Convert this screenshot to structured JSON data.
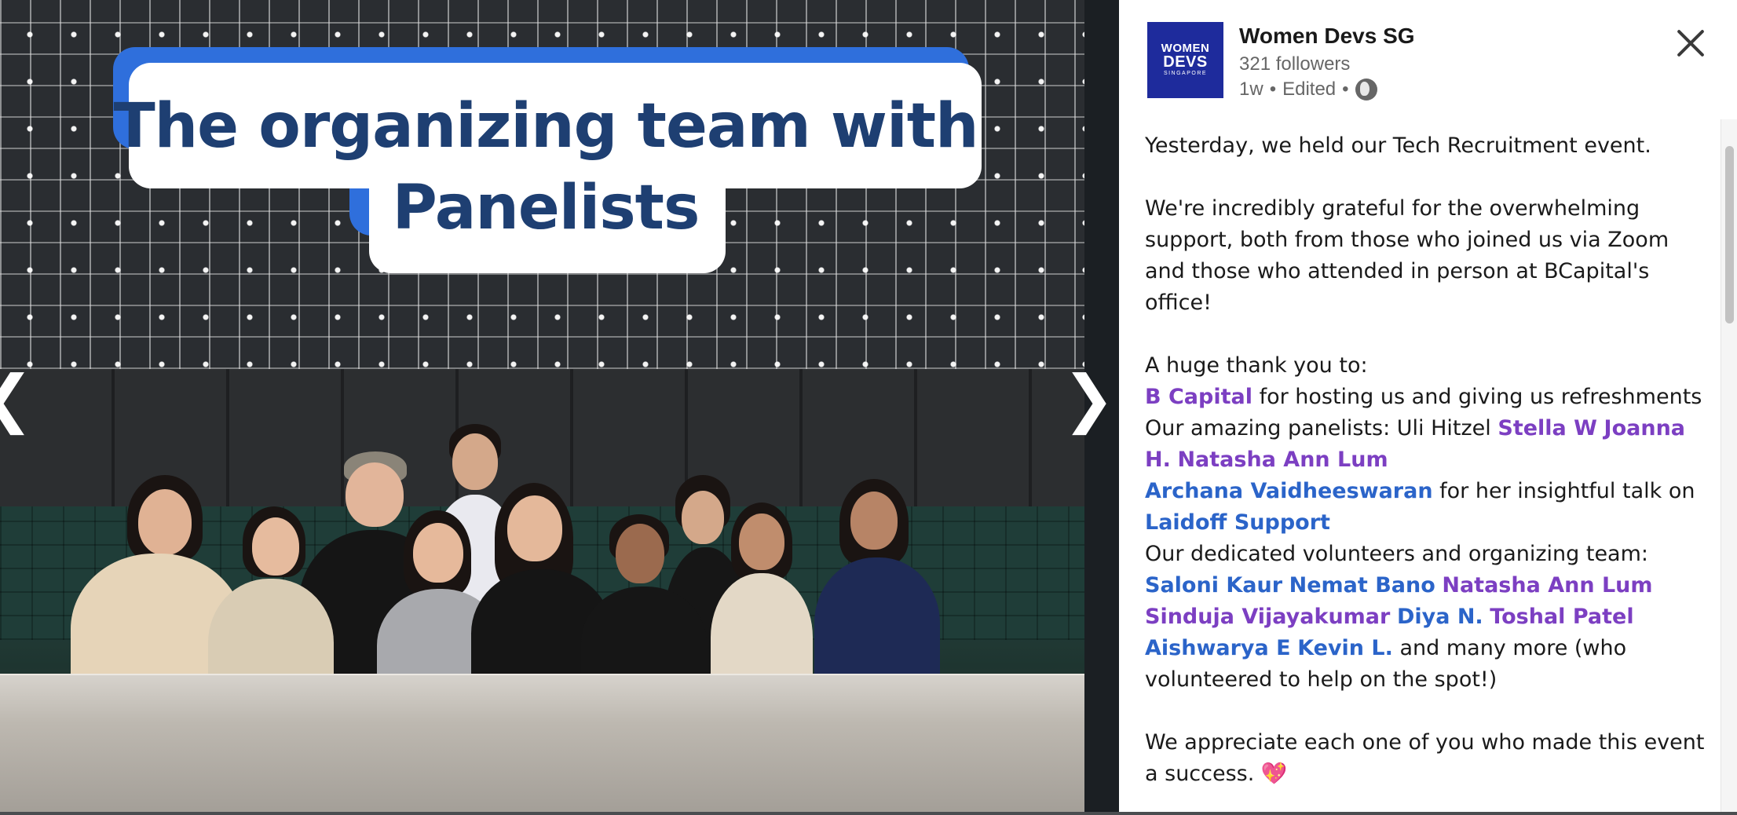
{
  "viewer": {
    "overlay_line1": "The organizing team with",
    "overlay_line2": "Panelists",
    "prev_glyph": "❮",
    "next_glyph": "❯"
  },
  "post": {
    "logo": {
      "line1": "WOMEN",
      "line2": "DEVS",
      "line3": "SINGAPORE"
    },
    "org_name": "Women Devs SG",
    "followers": "321 followers",
    "time": "1w",
    "edited": "Edited",
    "separator": "•",
    "intro": "Yesterday, we held our Tech Recruitment event.",
    "gratitude": "We're incredibly grateful for the overwhelming support, both from those who joined us via Zoom and those who attended in person at BCapital's office!",
    "thanks_heading": "A huge thank you to:",
    "b_capital": "B Capital",
    "b_capital_rest": " for hosting us and giving us refreshments",
    "panelists_prefix": "Our amazing panelists: Uli Hitzel ",
    "panelist_stella": "Stella W",
    "panelist_joanna": "Joanna H.",
    "panelist_natasha": "Natasha Ann Lum",
    "speaker": "Archana Vaidheeswaran",
    "speaker_rest": " for her insightful talk on ",
    "talk_topic": "Laidoff Support",
    "volunteers_prefix": "Our dedicated volunteers and organizing team: ",
    "vol_saloni": "Saloni Kaur",
    "vol_nemat": "Nemat Bano",
    "vol_natasha": "Natasha Ann Lum",
    "vol_sinduja": "Sinduja Vijayakumar",
    "vol_diya": "Diya N.",
    "vol_toshal": "Toshal Patel",
    "vol_aishwarya": "Aishwarya E",
    "vol_kevin": "Kevin L.",
    "volunteers_rest": " and many more (who volunteered to help on the spot!)",
    "closing": "We appreciate each one of you who made this event a success. ",
    "heart": "💖"
  },
  "colors": {
    "mention_purple": "#7c3fc2",
    "mention_blue": "#2b64c9",
    "overlay_text": "#1e3f72",
    "overlay_accent": "#2f6fdc",
    "logo_bg": "#1e2b9c"
  },
  "icons": [
    "chevron-left-icon",
    "chevron-right-icon",
    "globe-icon",
    "close-icon"
  ]
}
